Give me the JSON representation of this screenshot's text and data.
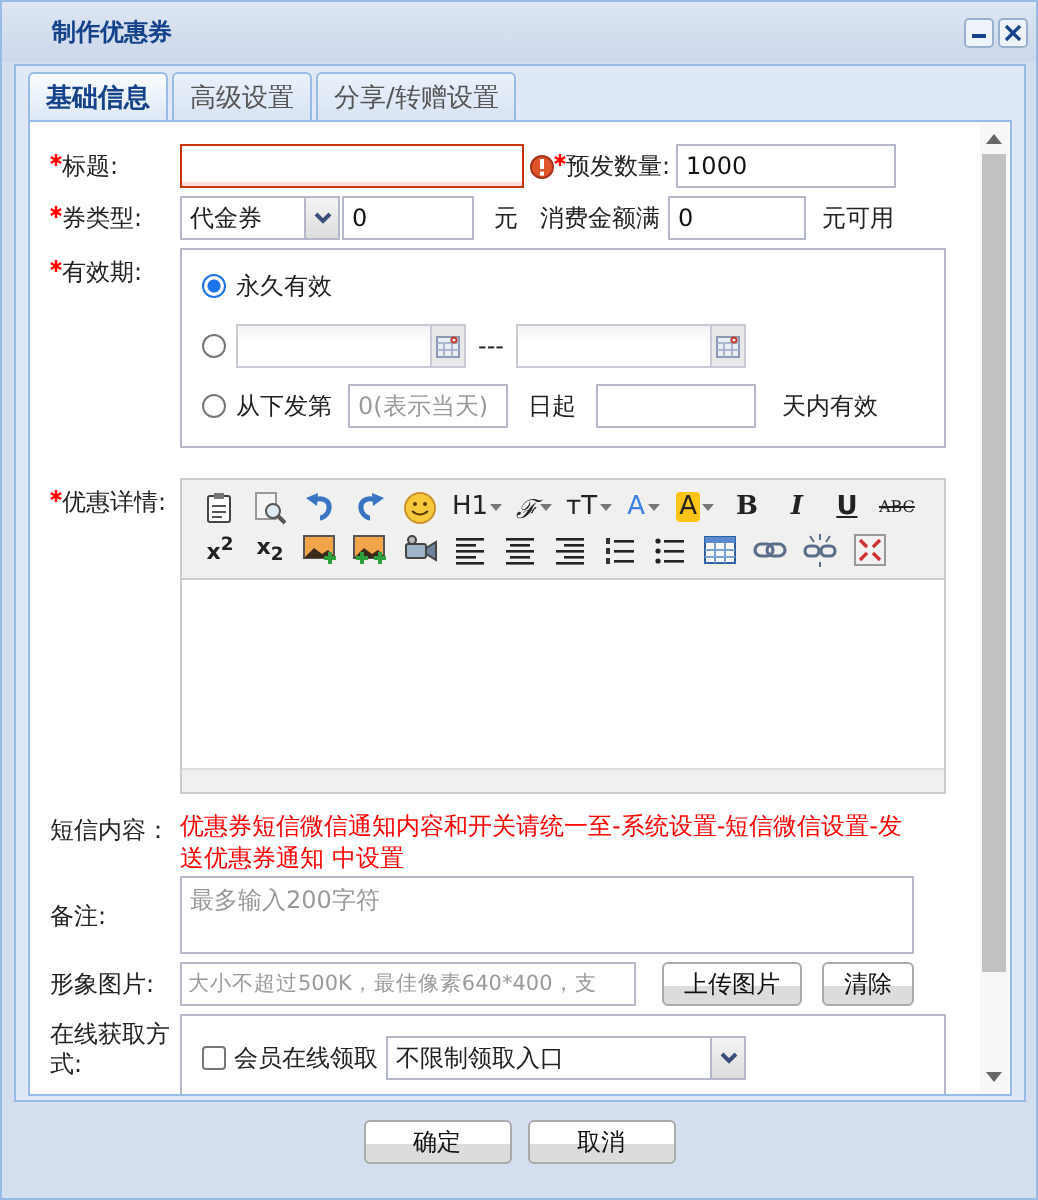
{
  "window": {
    "title": "制作优惠券"
  },
  "tabs": [
    {
      "label": "基础信息",
      "selected": true
    },
    {
      "label": "高级设置",
      "selected": false
    },
    {
      "label": "分享/转赠设置",
      "selected": false
    }
  ],
  "title_field": {
    "label": "标题:",
    "required": true,
    "invalid": true
  },
  "quantity": {
    "label": "预发数量:",
    "required": true,
    "value": "1000"
  },
  "coupon_type": {
    "label": "券类型:",
    "required": true,
    "select": "代金券",
    "amount": "0",
    "unit": "元",
    "min_label": "消费金额满",
    "min_value": "0",
    "min_suffix": "元可用"
  },
  "validity": {
    "label": "有效期:",
    "required": true,
    "options": [
      {
        "kind": "permanent",
        "selected": true,
        "label": "永久有效"
      },
      {
        "kind": "date-range",
        "selected": false,
        "separator": "---"
      },
      {
        "kind": "relative",
        "selected": false,
        "prefix": "从下发第",
        "placeholder": "0(表示当天)",
        "middle": "日起",
        "suffix": "天内有效"
      }
    ]
  },
  "details": {
    "label": "优惠详情:",
    "required": true,
    "toolbar": [
      [
        {
          "kind": "paste"
        },
        {
          "kind": "preview"
        },
        {
          "kind": "undo"
        },
        {
          "kind": "redo"
        },
        {
          "kind": "emoticon"
        },
        {
          "kind": "heading",
          "label": "H1"
        },
        {
          "kind": "font-family",
          "label": "ℱ"
        },
        {
          "kind": "font-size",
          "label": "тT"
        },
        {
          "kind": "font-color",
          "label": "A"
        },
        {
          "kind": "highlight",
          "label": "A"
        },
        {
          "kind": "bold",
          "label": "B"
        },
        {
          "kind": "italic",
          "label": "I"
        },
        {
          "kind": "underline",
          "label": "U"
        },
        {
          "kind": "strikethrough",
          "label": "ABC"
        }
      ],
      [
        {
          "kind": "superscript",
          "label": "x$^{2}$"
        },
        {
          "kind": "subscript",
          "label": "x$_{2}$"
        },
        {
          "kind": "image"
        },
        {
          "kind": "multi-image"
        },
        {
          "kind": "video"
        },
        {
          "kind": "align-left"
        },
        {
          "kind": "align-center"
        },
        {
          "kind": "align-right"
        },
        {
          "kind": "ordered-list"
        },
        {
          "kind": "unordered-list"
        },
        {
          "kind": "table"
        },
        {
          "kind": "link"
        },
        {
          "kind": "unlink"
        },
        {
          "kind": "fullscreen"
        }
      ]
    ]
  },
  "sms": {
    "label": "短信内容：",
    "text": "优惠券短信微信通知内容和开关请统一至-系统设置-短信微信设置-发送优惠券通知 中设置"
  },
  "remarks": {
    "label": "备注:",
    "placeholder": "最多输入200字符"
  },
  "image": {
    "label": "形象图片:",
    "placeholder": "大小不超过500K，最佳像素640*400，支",
    "buttons": [
      "上传图片",
      "清除"
    ]
  },
  "online": {
    "label": "在线获取方式:",
    "checked": false,
    "option": "会员在线领取",
    "select": "不限制领取入口"
  },
  "footer": {
    "buttons": [
      "确定",
      "取消"
    ]
  }
}
